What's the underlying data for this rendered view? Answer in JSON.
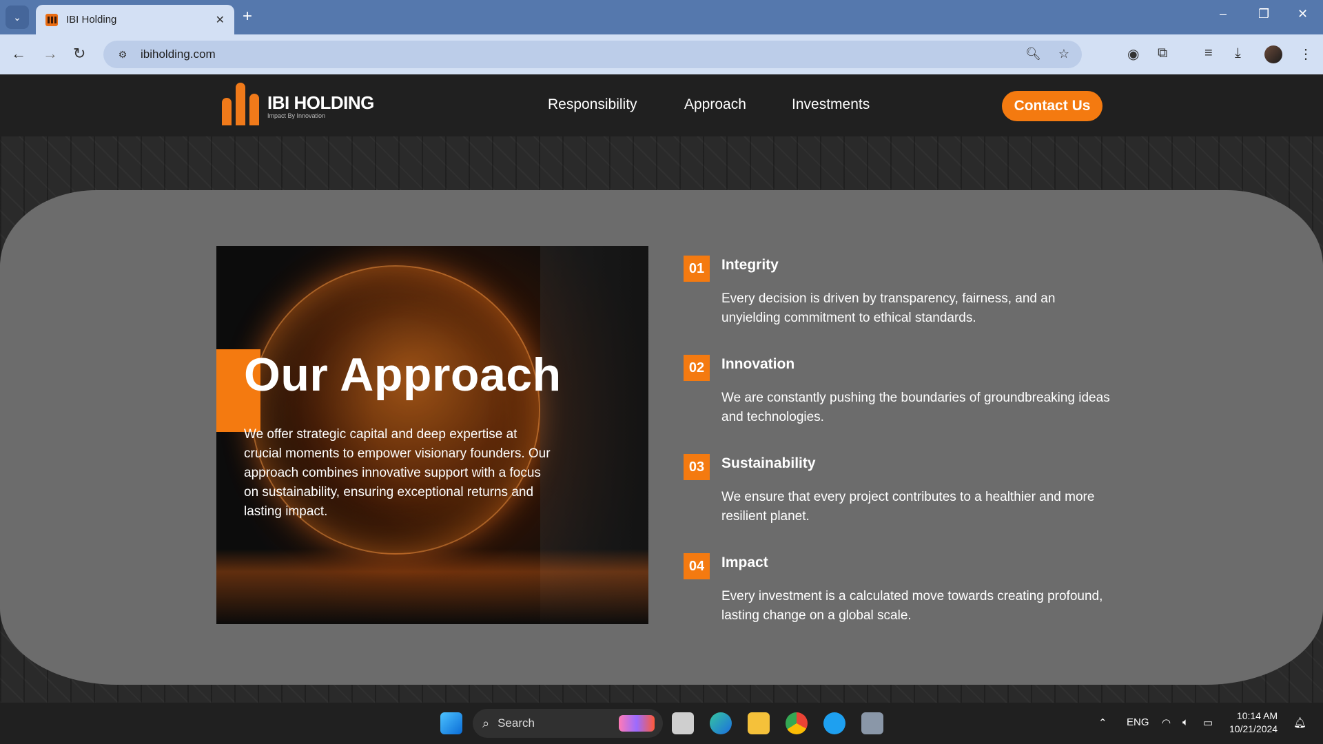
{
  "browser": {
    "tab_title": "IBI Holding",
    "tab_close": "✕",
    "new_tab": "+",
    "url": "ibiholding.com",
    "controls": {
      "minimize": "–",
      "restore": "❐",
      "close": "✕"
    }
  },
  "site": {
    "brand": "IBI HOLDING",
    "tagline": "Impact By Innovation",
    "nav": [
      "Responsibility",
      "Approach",
      "Investments"
    ],
    "cta": "Contact Us",
    "accent": "#f47a10",
    "hero": {
      "title": "Our Approach",
      "text": "We offer strategic capital and deep expertise at crucial moments to empower visionary founders. Our approach combines innovative support with a focus on sustainability, ensuring exceptional returns and lasting impact."
    },
    "values": [
      {
        "num": "01",
        "title": "Integrity",
        "desc": "Every decision is driven by transparency, fairness, and an unyielding commitment to ethical standards."
      },
      {
        "num": "02",
        "title": "Innovation",
        "desc": "We are constantly pushing the boundaries of groundbreaking ideas and technologies."
      },
      {
        "num": "03",
        "title": "Sustainability",
        "desc": "We ensure that every project contributes to a healthier and more resilient planet."
      },
      {
        "num": "04",
        "title": "Impact",
        "desc": "Every investment is a calculated move towards creating profound, lasting change on a global scale."
      }
    ]
  },
  "taskbar": {
    "search_placeholder": "Search",
    "language": "ENG",
    "time": "10:14 AM",
    "date": "10/21/2024"
  }
}
